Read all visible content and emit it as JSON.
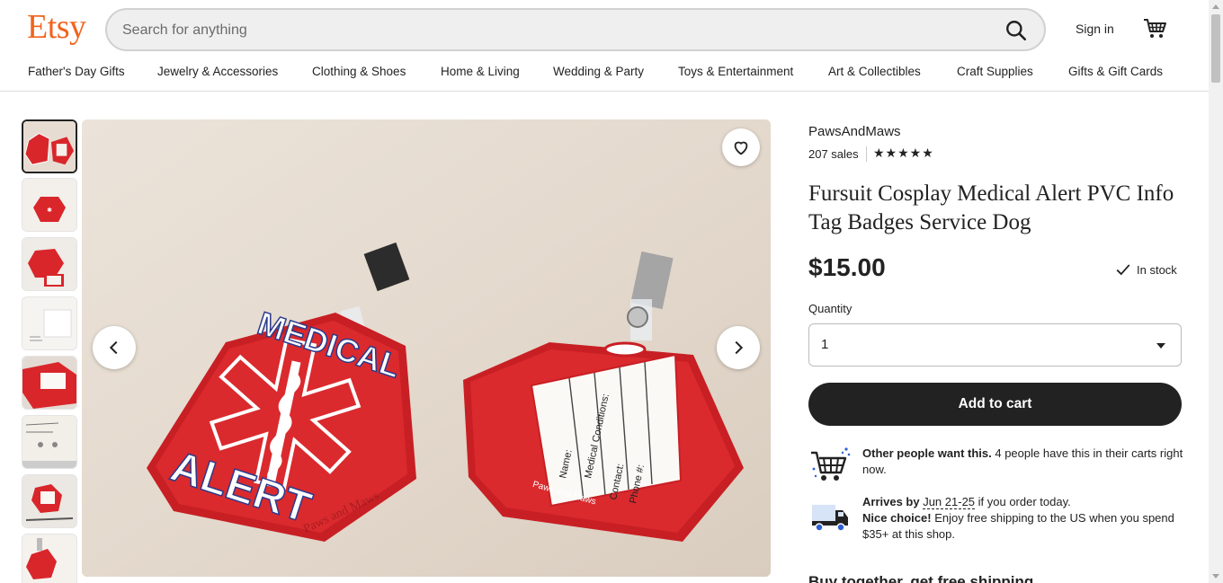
{
  "header": {
    "logo": "Etsy",
    "search_placeholder": "Search for anything",
    "sign_in": "Sign in"
  },
  "categories": [
    "Father's Day Gifts",
    "Jewelry & Accessories",
    "Clothing & Shoes",
    "Home & Living",
    "Wedding & Party",
    "Toys & Entertainment",
    "Art & Collectibles",
    "Craft Supplies",
    "Gifts & Gift Cards"
  ],
  "listing": {
    "shop_name": "PawsAndMaws",
    "sales": "207 sales",
    "rating_stars": "★★★★★",
    "title": "Fursuit Cosplay Medical Alert PVC Info Tag Badges Service Dog",
    "price": "$15.00",
    "stock": "In stock",
    "quantity_label": "Quantity",
    "quantity_value": "1",
    "add_to_cart": "Add to cart"
  },
  "promos": {
    "demand_bold": "Other people want this.",
    "demand_text": " 4 people have this in their carts right now.",
    "arrives_prefix": "Arrives by ",
    "arrives_date": "Jun 21-25",
    "arrives_suffix": " if you order today.",
    "shipping_bold": "Nice choice!",
    "shipping_text": " Enjoy free shipping to the US when you spend $35+ at this shop."
  },
  "partial_heading": "Buy together, get free shipping",
  "image_text": {
    "tag_left_line1": "MEDICAL",
    "tag_left_line2": "ALERT",
    "tag_right_fields": [
      "Name:",
      "Medical Conditions:",
      "Contact:",
      "Phone #:"
    ],
    "tag_right_brand": "Paws and Maws",
    "watermark": "Paws and Maws"
  },
  "colors": {
    "brand": "#F1641E",
    "tag_red": "#D9262B",
    "button_dark": "#222222"
  },
  "icons": [
    "search-icon",
    "cart-icon",
    "heart-icon",
    "chevron-left-icon",
    "chevron-right-icon",
    "check-icon",
    "cart-demand-icon",
    "truck-icon"
  ]
}
